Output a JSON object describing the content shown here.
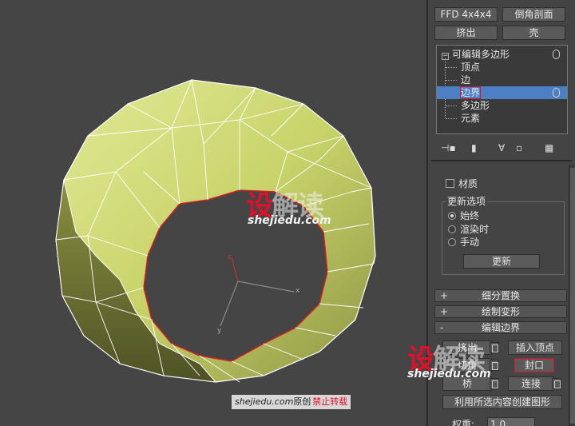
{
  "panel": {
    "top_buttons": [
      "FFD 4x4x4",
      "倒角剖面",
      "挤出",
      "壳"
    ],
    "stack": {
      "root": "可编辑多边形",
      "subs": [
        "顶点",
        "边",
        "边界",
        "多边形",
        "元素"
      ]
    },
    "material_label": "材质",
    "update_group": {
      "title": "更新选项",
      "options": [
        "始终",
        "渲染时",
        "手动"
      ],
      "update_button": "更新"
    },
    "rollouts": [
      {
        "sign": "+",
        "label": "细分置换"
      },
      {
        "sign": "+",
        "label": "绘制变形"
      },
      {
        "sign": "-",
        "label": "编辑边界"
      }
    ],
    "edit_border": {
      "extrude": "挤出",
      "insert_vertex": "插入顶点",
      "chamfer": "切角",
      "cap": "封口",
      "bridge": "桥",
      "connect": "连接",
      "create_shape": "利用所选内容创建图形",
      "weight_label": "权重:",
      "weight_value": "1.0"
    }
  },
  "viewport": {
    "axis_labels": [
      "z",
      "x",
      "y"
    ]
  },
  "watermark": {
    "big_red": "设",
    "big_rest": "解读",
    "site": "shejiedu.com",
    "credit_site": "shejiedu.com",
    "credit_original": "原创",
    "credit_warning": "禁止转载"
  },
  "colors": {
    "mesh_fill": "#c9d36a",
    "mesh_dark": "#6b7030",
    "border_red": "#d02020",
    "selection_blue": "#4d7fc4",
    "watermark_red": "#e0102a"
  }
}
